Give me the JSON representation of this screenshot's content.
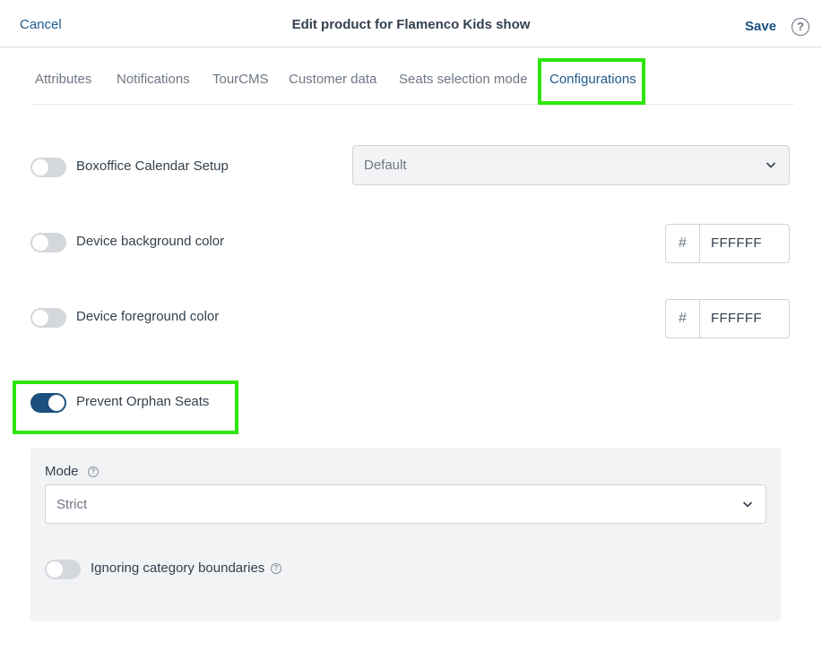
{
  "header": {
    "cancel_label": "Cancel",
    "title": "Edit product for Flamenco Kids show",
    "save_label": "Save",
    "help_symbol": "?"
  },
  "tabs": [
    {
      "label": "Attributes",
      "active": false
    },
    {
      "label": "Notifications",
      "active": false
    },
    {
      "label": "TourCMS",
      "active": false
    },
    {
      "label": "Customer data",
      "active": false
    },
    {
      "label": "Seats selection mode",
      "active": false
    },
    {
      "label": "Configurations",
      "active": true
    }
  ],
  "settings": {
    "boxoffice": {
      "label": "Boxoffice Calendar Setup",
      "enabled": false,
      "select_value": "Default"
    },
    "device_bg": {
      "label": "Device background color",
      "enabled": false,
      "prefix": "#",
      "value": "FFFFFF"
    },
    "device_fg": {
      "label": "Device foreground color",
      "enabled": false,
      "prefix": "#",
      "value": "FFFFFF"
    },
    "orphan": {
      "label": "Prevent Orphan Seats",
      "enabled": true
    }
  },
  "orphan_panel": {
    "mode_label": "Mode",
    "mode_value": "Strict",
    "ignore_label": "Ignoring category boundaries",
    "ignore_enabled": false
  },
  "colors": {
    "accent": "#1a4f7e",
    "highlight": "#2ee60e",
    "toggle_off": "#d4d7dc"
  },
  "icons": {
    "help": "question-circle-icon",
    "chevron": "chevron-down-icon",
    "info": "info-circle-icon"
  }
}
